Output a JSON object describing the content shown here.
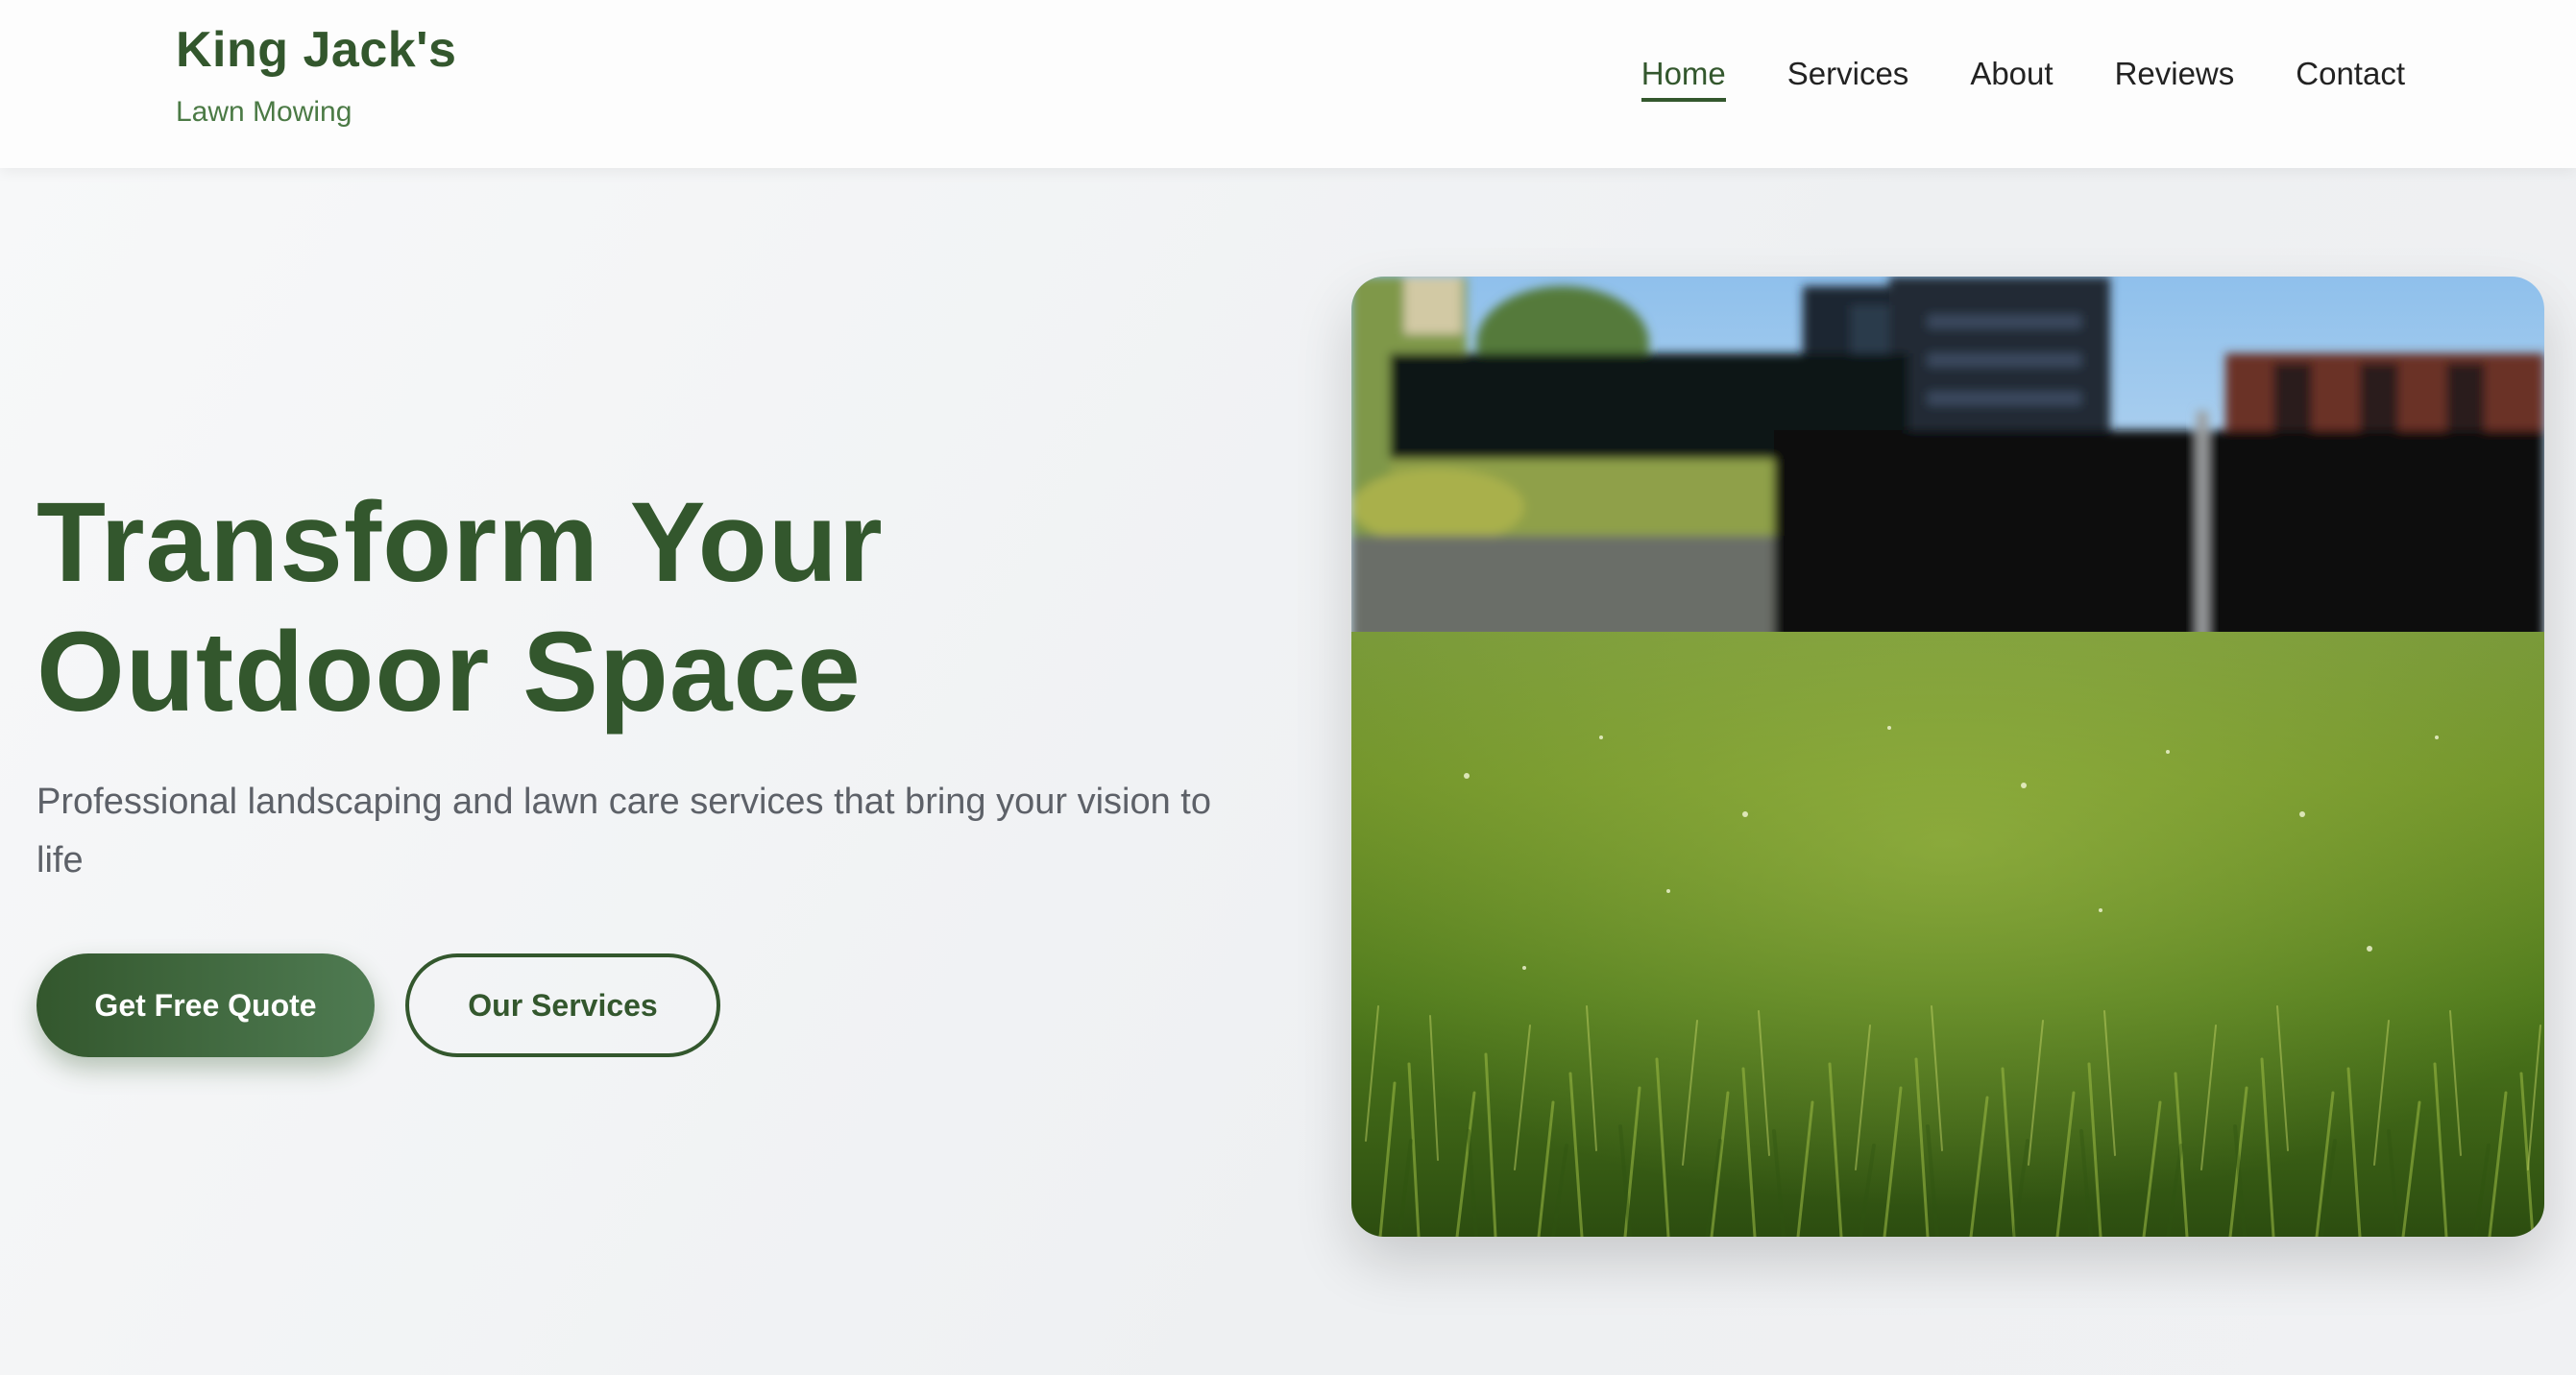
{
  "brand": {
    "title": "King Jack's",
    "subtitle": "Lawn Mowing"
  },
  "nav": {
    "items": [
      {
        "label": "Home",
        "active": true
      },
      {
        "label": "Services",
        "active": false
      },
      {
        "label": "About",
        "active": false
      },
      {
        "label": "Reviews",
        "active": false
      },
      {
        "label": "Contact",
        "active": false
      }
    ]
  },
  "hero": {
    "title_line1": "Transform Your",
    "title_line2": "Outdoor Space",
    "subtitle": "Professional landscaping and lawn care services that bring your vision to life",
    "primary_button": "Get Free Quote",
    "secondary_button": "Our Services",
    "image_subject": "close-up of green lawn grass with blurred buildings in background"
  },
  "colors": {
    "brand_green": "#33572d",
    "accent_green": "#4f7b52",
    "text_gray": "#5d6168",
    "page_bg": "#f1f2f4"
  }
}
